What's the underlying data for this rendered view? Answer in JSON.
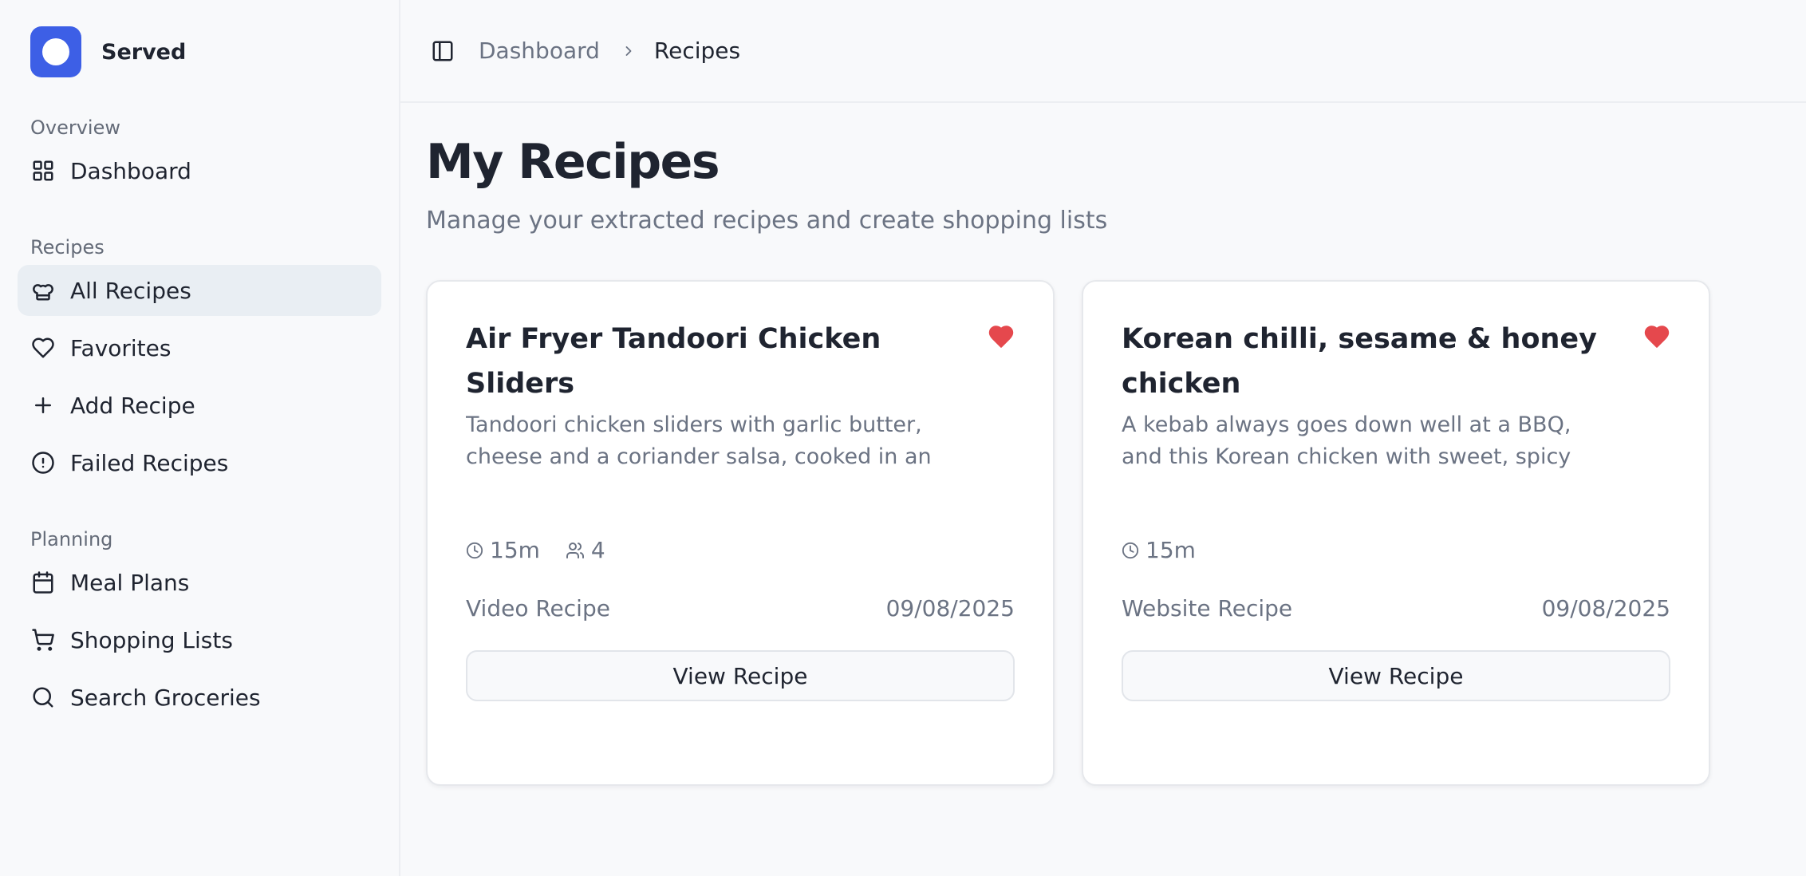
{
  "brand": {
    "name": "Served",
    "accent": "#3d5fe6"
  },
  "sidebar": {
    "sections": [
      {
        "label": "Overview",
        "items": [
          {
            "label": "Dashboard",
            "icon": "grid-icon"
          }
        ]
      },
      {
        "label": "Recipes",
        "items": [
          {
            "label": "All Recipes",
            "icon": "chef-hat-icon",
            "active": true
          },
          {
            "label": "Favorites",
            "icon": "heart-outline-icon"
          },
          {
            "label": "Add Recipe",
            "icon": "plus-icon"
          },
          {
            "label": "Failed Recipes",
            "icon": "alert-circle-icon"
          }
        ]
      },
      {
        "label": "Planning",
        "items": [
          {
            "label": "Meal Plans",
            "icon": "calendar-icon"
          },
          {
            "label": "Shopping Lists",
            "icon": "cart-icon"
          },
          {
            "label": "Search Groceries",
            "icon": "search-icon"
          }
        ]
      }
    ]
  },
  "breadcrumb": {
    "parent": "Dashboard",
    "current": "Recipes"
  },
  "page": {
    "title": "My Recipes",
    "subtitle": "Manage your extracted recipes and create shopping lists"
  },
  "recipes": [
    {
      "title": "Air Fryer Tandoori Chicken Sliders",
      "description": "Tandoori chicken sliders with garlic butter, cheese and a coriander salsa, cooked in an air…",
      "time": "15m",
      "servings": "4",
      "source": "Video Recipe",
      "date": "09/08/2025",
      "favorite": true,
      "button": "View Recipe"
    },
    {
      "title": "Korean chilli, sesame & honey chicken",
      "description": "A kebab always goes down well at a BBQ, and this Korean chicken with sweet, spicy and sticky…",
      "time": "15m",
      "source": "Website Recipe",
      "date": "09/08/2025",
      "favorite": true,
      "button": "View Recipe"
    }
  ],
  "colors": {
    "favorite": "#e5484d",
    "active_nav_bg": "#e9eef3"
  }
}
